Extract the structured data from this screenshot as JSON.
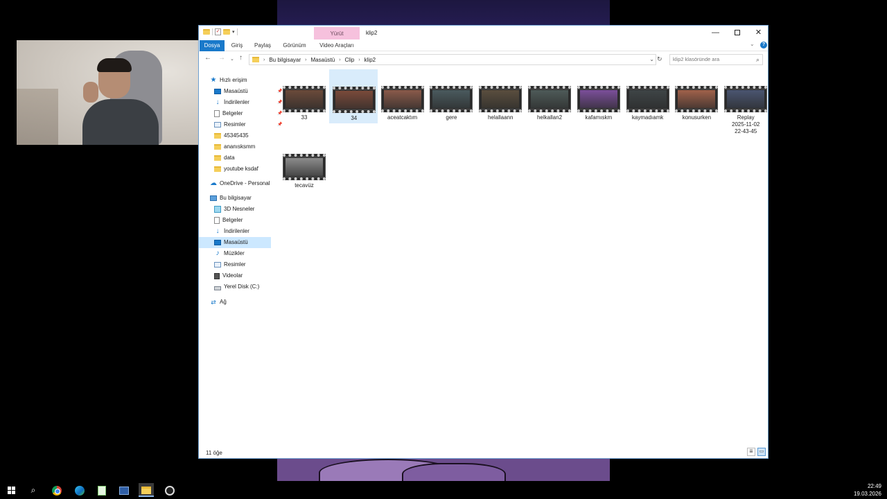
{
  "window": {
    "title": "klip2",
    "tool_tab": "Yürüt",
    "controls": [
      "minimize",
      "maximize",
      "close"
    ]
  },
  "ribbon": {
    "tabs": [
      "Dosya",
      "Giriş",
      "Paylaş",
      "Görünüm",
      "Video Araçları"
    ],
    "accent": "#1979ca",
    "tool_tab_color": "#f6c1dd"
  },
  "address": {
    "crumbs": [
      "Bu bilgisayar",
      "Masaüstü",
      "Clip",
      "klip2"
    ],
    "search_placeholder": "klip2 klasöründe ara"
  },
  "nav": {
    "quick_access": {
      "label": "Hızlı erişim",
      "items": [
        {
          "label": "Masaüstü",
          "icon": "desktop-icon",
          "pinned": true
        },
        {
          "label": "İndirilenler",
          "icon": "download-icon",
          "pinned": true
        },
        {
          "label": "Belgeler",
          "icon": "document-icon",
          "pinned": true
        },
        {
          "label": "Resimler",
          "icon": "pictures-icon",
          "pinned": true
        },
        {
          "label": "45345435",
          "icon": "folder-icon",
          "pinned": false
        },
        {
          "label": "ananısksmm",
          "icon": "folder-icon",
          "pinned": false
        },
        {
          "label": "data",
          "icon": "folder-icon",
          "pinned": false
        },
        {
          "label": "youtube ksdaf",
          "icon": "folder-icon",
          "pinned": false
        }
      ]
    },
    "onedrive": "OneDrive - Personal",
    "this_pc": {
      "label": "Bu bilgisayar",
      "items": [
        {
          "label": "3D Nesneler",
          "icon": "3d-objects-icon"
        },
        {
          "label": "Belgeler",
          "icon": "document-icon"
        },
        {
          "label": "İndirilenler",
          "icon": "download-icon"
        },
        {
          "label": "Masaüstü",
          "icon": "desktop-icon",
          "selected": true
        },
        {
          "label": "Müzikler",
          "icon": "music-icon"
        },
        {
          "label": "Resimler",
          "icon": "pictures-icon"
        },
        {
          "label": "Videolar",
          "icon": "videos-icon"
        },
        {
          "label": "Yerel Disk (C:)",
          "icon": "disk-icon"
        }
      ]
    },
    "network": "Ağ"
  },
  "files": [
    {
      "name": "33",
      "scene": "#6b4a3a",
      "selected": false
    },
    {
      "name": "34",
      "scene": "#7a4a3a",
      "selected": true
    },
    {
      "name": "aceatcaktım",
      "scene": "#8a5a4a",
      "selected": false
    },
    {
      "name": "gere",
      "scene": "#4a5a5e",
      "selected": false
    },
    {
      "name": "helallaann",
      "scene": "#5a4e3e",
      "selected": false
    },
    {
      "name": "helkallan2",
      "scene": "#4e5a58",
      "selected": false
    },
    {
      "name": "kafamıskm",
      "scene": "#7b4f9a",
      "selected": false
    },
    {
      "name": "kaymadıamk",
      "scene": "#3e4446",
      "selected": false
    },
    {
      "name": "konusurken",
      "scene": "#a0614a",
      "selected": false
    },
    {
      "name": "Replay 2025-11-02 22-43-45",
      "line1": "Replay",
      "line2": "2025-11-02",
      "line3": "22-43-45",
      "scene": "#4a5570",
      "selected": false
    },
    {
      "name": "tecavüz",
      "scene": "#8c8c8c",
      "selected": false
    }
  ],
  "status": {
    "count": "11 öğe"
  },
  "taskbar": {
    "time": "22:49",
    "date": "19.03.2026"
  }
}
